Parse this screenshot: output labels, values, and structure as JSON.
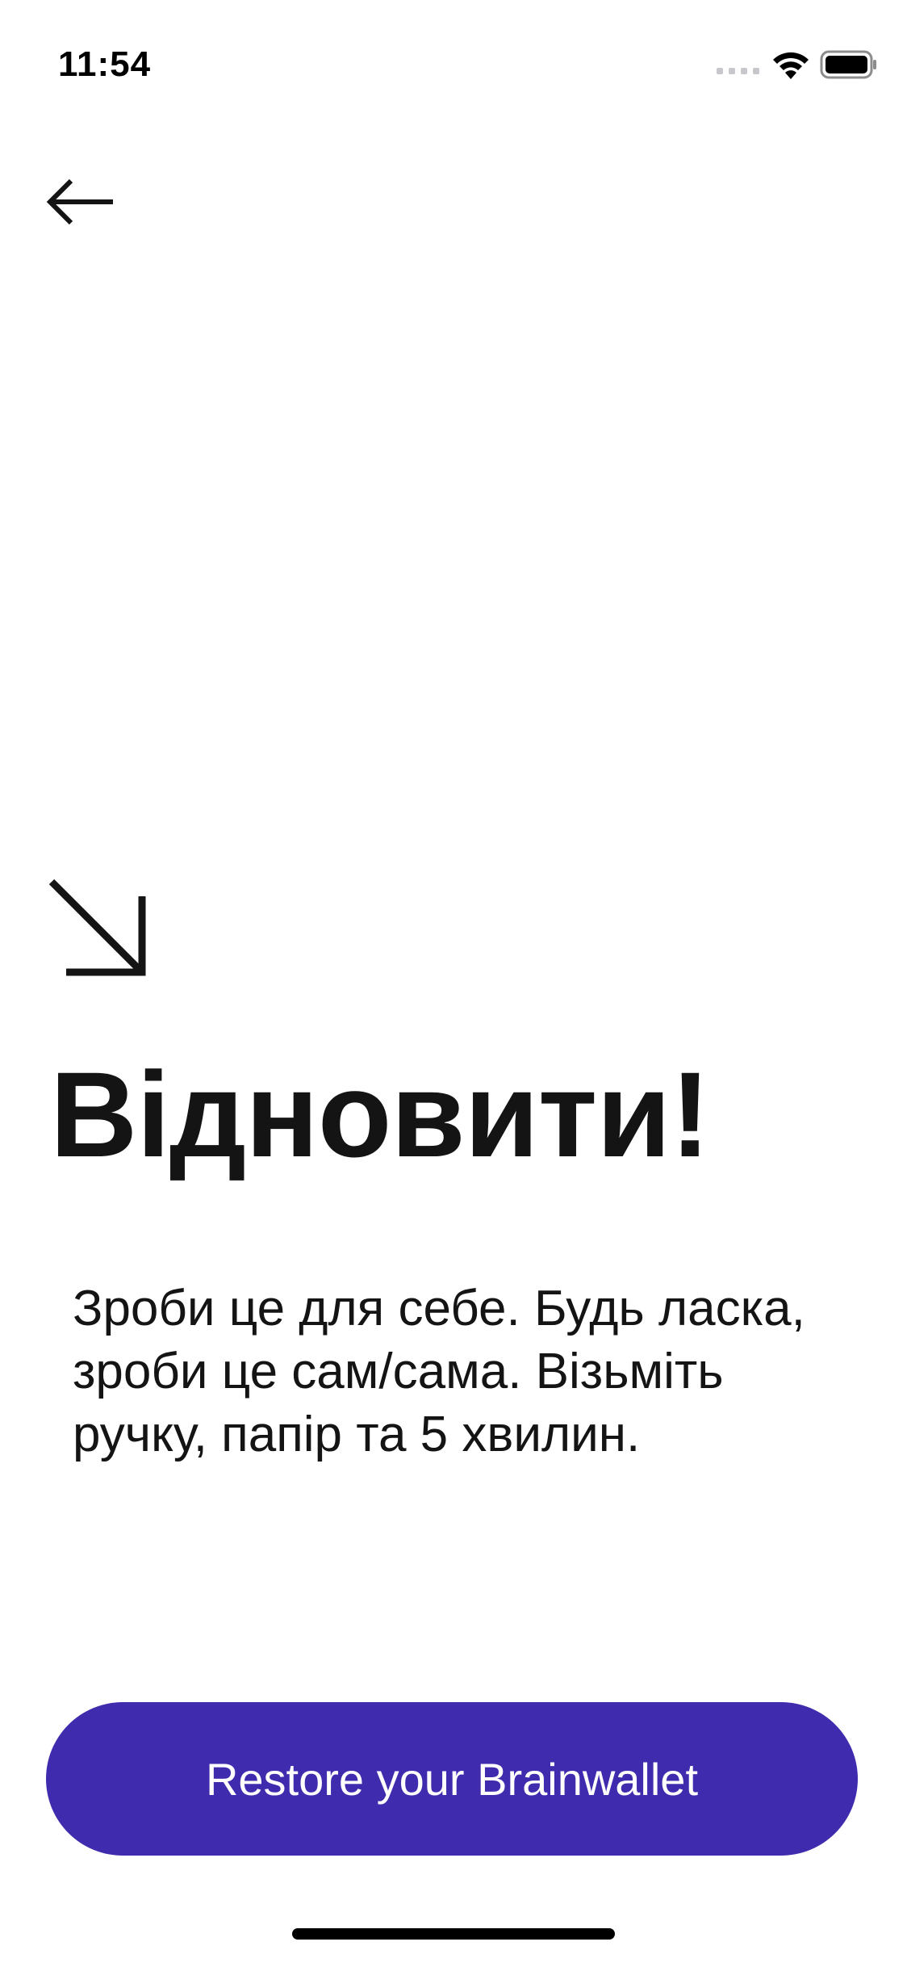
{
  "status_bar": {
    "time": "11:54"
  },
  "nav": {
    "back_icon": "arrow-left-icon"
  },
  "hero": {
    "icon": "arrow-down-right-icon",
    "title": "Відновити!",
    "description": "Зроби це для себе. Будь ласка, зроби це сам/сама. Візьміть ручку, папір та 5 хвилин."
  },
  "cta": {
    "label": "Restore your Brainwallet"
  },
  "colors": {
    "accent": "#3f2bad",
    "text": "#141414",
    "background": "#ffffff"
  }
}
